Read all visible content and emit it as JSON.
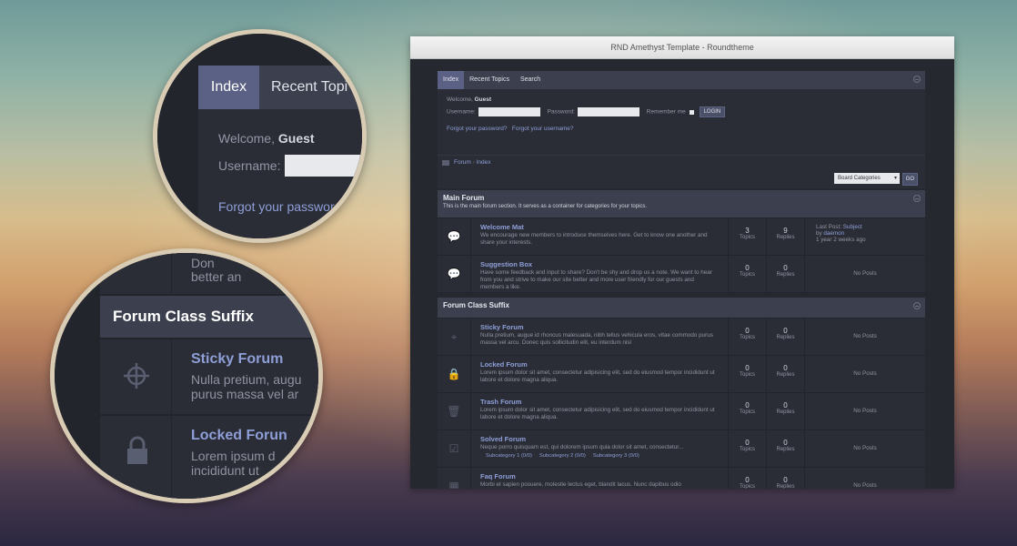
{
  "window": {
    "title": "RND Amethyst Template - Roundtheme"
  },
  "nav": {
    "items": [
      "Index",
      "Recent Topics",
      "Search"
    ]
  },
  "login": {
    "welcome": "Welcome,",
    "user": "Guest",
    "username_label": "Username:",
    "password_label": "Password:",
    "remember_label": "Remember me",
    "login_button": "LOGIN",
    "forgot_password": "Forgot your password?",
    "forgot_username": "Forgot your username?"
  },
  "breadcrumb": {
    "root": "Forum",
    "sep": "›",
    "current": "Index"
  },
  "jump": {
    "selected": "Board Categories",
    "go": "GO"
  },
  "main": {
    "title": "Main Forum",
    "desc": "This is the main forum section. It serves as a container for categories for your topics.",
    "forums": [
      {
        "name": "Welcome Mat",
        "desc": "We encourage new members to introduce themselves here. Get to know one another and share your interests.",
        "topics": "3",
        "replies": "9",
        "topics_label": "Topics",
        "replies_label": "Replies",
        "last_label": "Last Post:",
        "last_subject": "Subject",
        "last_by": "by",
        "last_user": "daemon",
        "last_time": "1 year 2 weeks ago"
      },
      {
        "name": "Suggestion Box",
        "desc": "Have some feedback and input to share? Don't be shy and drop us a note. We want to hear from you and strive to make our site better and more user friendly for our guests and members a like.",
        "topics": "0",
        "replies": "0",
        "topics_label": "Topics",
        "replies_label": "Replies",
        "no_posts": "No Posts"
      }
    ]
  },
  "suffix": {
    "title": "Forum Class Suffix",
    "forums": [
      {
        "name": "Sticky Forum",
        "desc": "Nulla pretium, augue id rhoncus malesuada, nibh tellus vehicula eros, vitae commodo purus massa vel arcu. Donec quis sollicitudin elit, eu interdum nisl",
        "topics": "0",
        "replies": "0",
        "no_posts": "No Posts",
        "icon": "crosshair-icon"
      },
      {
        "name": "Locked Forum",
        "desc": "Lorem ipsum dolor sit amet, consectetur adipisicing elit, sed do eiusmod tempor incididunt ut labore et dolore magna aliqua.",
        "topics": "0",
        "replies": "0",
        "no_posts": "No Posts",
        "icon": "lock-icon"
      },
      {
        "name": "Trash Forum",
        "desc": "Lorem ipsum dolor sit amet, consectetur adipisicing elit, sed do eiusmod tempor incididunt ut labore et dolore magna aliqua.",
        "topics": "0",
        "replies": "0",
        "no_posts": "No Posts",
        "icon": "trash-icon"
      },
      {
        "name": "Solved Forum",
        "desc": "Neque porro quisquam est, qui dolorem ipsum quia dolor sit amet, consectetur...",
        "topics": "0",
        "replies": "0",
        "no_posts": "No Posts",
        "icon": "check-icon",
        "subs": [
          "Subcategory 1 (0/0)",
          "Subcategory 2 (0/0)",
          "Subcategory 3 (0/0)"
        ]
      },
      {
        "name": "Faq Forum",
        "desc": "Morbi et sapien posuere, molestie lectus eget, blandit lacus. Nunc dapibus odio",
        "topics": "0",
        "replies": "0",
        "no_posts": "No Posts",
        "icon": "calendar-icon"
      }
    ]
  },
  "zoom1": {
    "index": "Index",
    "recent": "Recent Topi",
    "welcome": "Welcome,",
    "user": "Guest",
    "username_label": "Username:",
    "forgot": "Forgot your passwor"
  },
  "zoom2": {
    "frag1": "Don",
    "frag2": "better an",
    "title": "Forum Class Suffix",
    "f1_name": "Sticky Forum",
    "f1_l1": "Nulla pretium, augu",
    "f1_l2": "purus massa vel ar",
    "f2_name": "Locked Forun",
    "f2_l1": "Lorem ipsum d",
    "f2_l2": "incididunt ut"
  }
}
